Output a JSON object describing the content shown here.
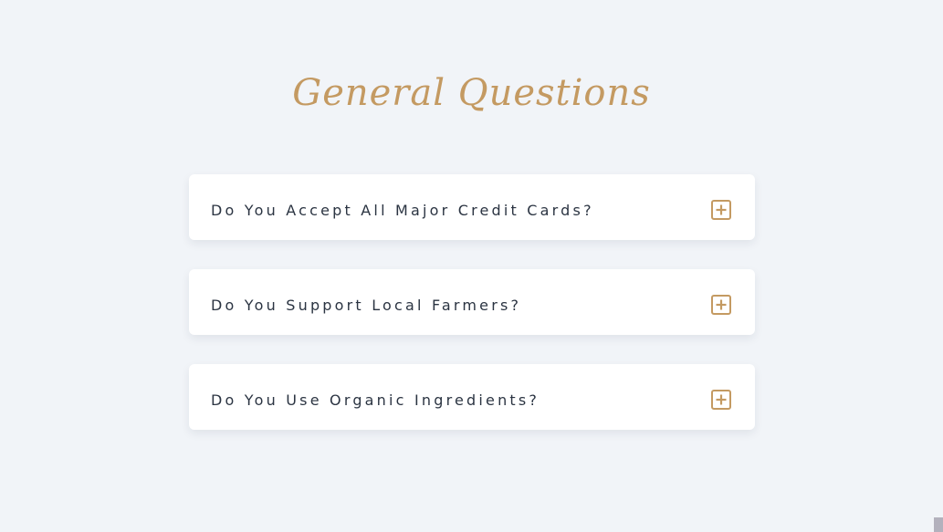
{
  "section": {
    "title": "General Questions"
  },
  "faq": {
    "items": [
      {
        "question": "Do You Accept All Major Credit Cards?",
        "icon": "plus-square-icon"
      },
      {
        "question": "Do You Support Local Farmers?",
        "icon": "plus-square-icon"
      },
      {
        "question": "Do You Use Organic Ingredients?",
        "icon": "plus-square-icon"
      }
    ]
  },
  "colors": {
    "background": "#f1f4f8",
    "accent": "#c49a62",
    "question_text": "#2b3442",
    "card": "#ffffff"
  }
}
